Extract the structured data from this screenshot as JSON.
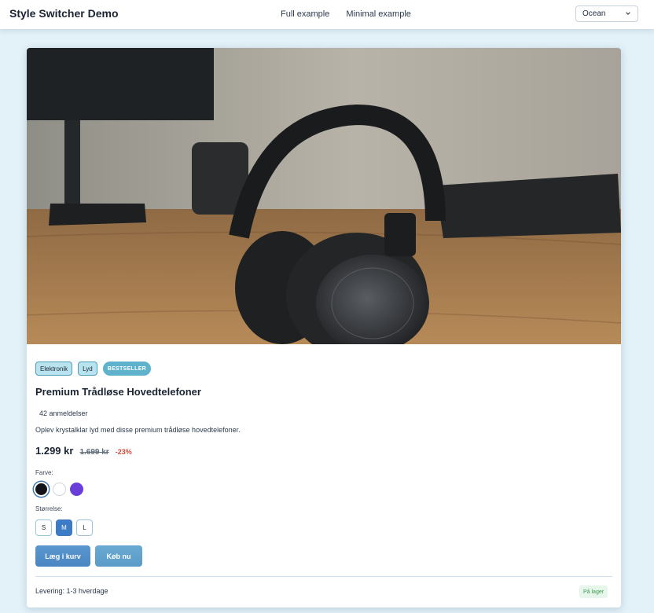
{
  "header": {
    "brand": "Style Switcher Demo",
    "nav": [
      "Full example",
      "Minimal example"
    ],
    "theme_select": {
      "value": "Ocean"
    }
  },
  "product": {
    "image_icon": "headphones-photo",
    "tags": [
      "Elektronik",
      "Lyd"
    ],
    "badge": "BESTSELLER",
    "title": "Premium Trådløse Hovedtelefoner",
    "reviews": "42 anmeldelser",
    "description": "Oplev krystalklar lyd med disse premium trådløse hovedtelefoner.",
    "price": "1.299 kr",
    "old_price": "1.699 kr",
    "discount": "-23%",
    "color_label": "Farve:",
    "colors": [
      {
        "name": "black",
        "hex": "#12141a",
        "selected": true
      },
      {
        "name": "white",
        "hex": "#ffffff",
        "selected": false
      },
      {
        "name": "purple",
        "hex": "#6a3fd9",
        "selected": false
      }
    ],
    "size_label": "Størrelse:",
    "sizes": [
      {
        "label": "S",
        "selected": false
      },
      {
        "label": "M",
        "selected": true
      },
      {
        "label": "L",
        "selected": false
      }
    ],
    "add_to_cart": "Læg i kurv",
    "buy_now": "Køb nu",
    "delivery": "Levering: 1-3 hverdage",
    "stock": "På lager"
  },
  "colors": {
    "page_bg": "#e3f1f8",
    "accent": "#3d7bc6",
    "badge": "#5fb2cc",
    "discount": "#d24a3a",
    "stock_text": "#3b9a55"
  }
}
